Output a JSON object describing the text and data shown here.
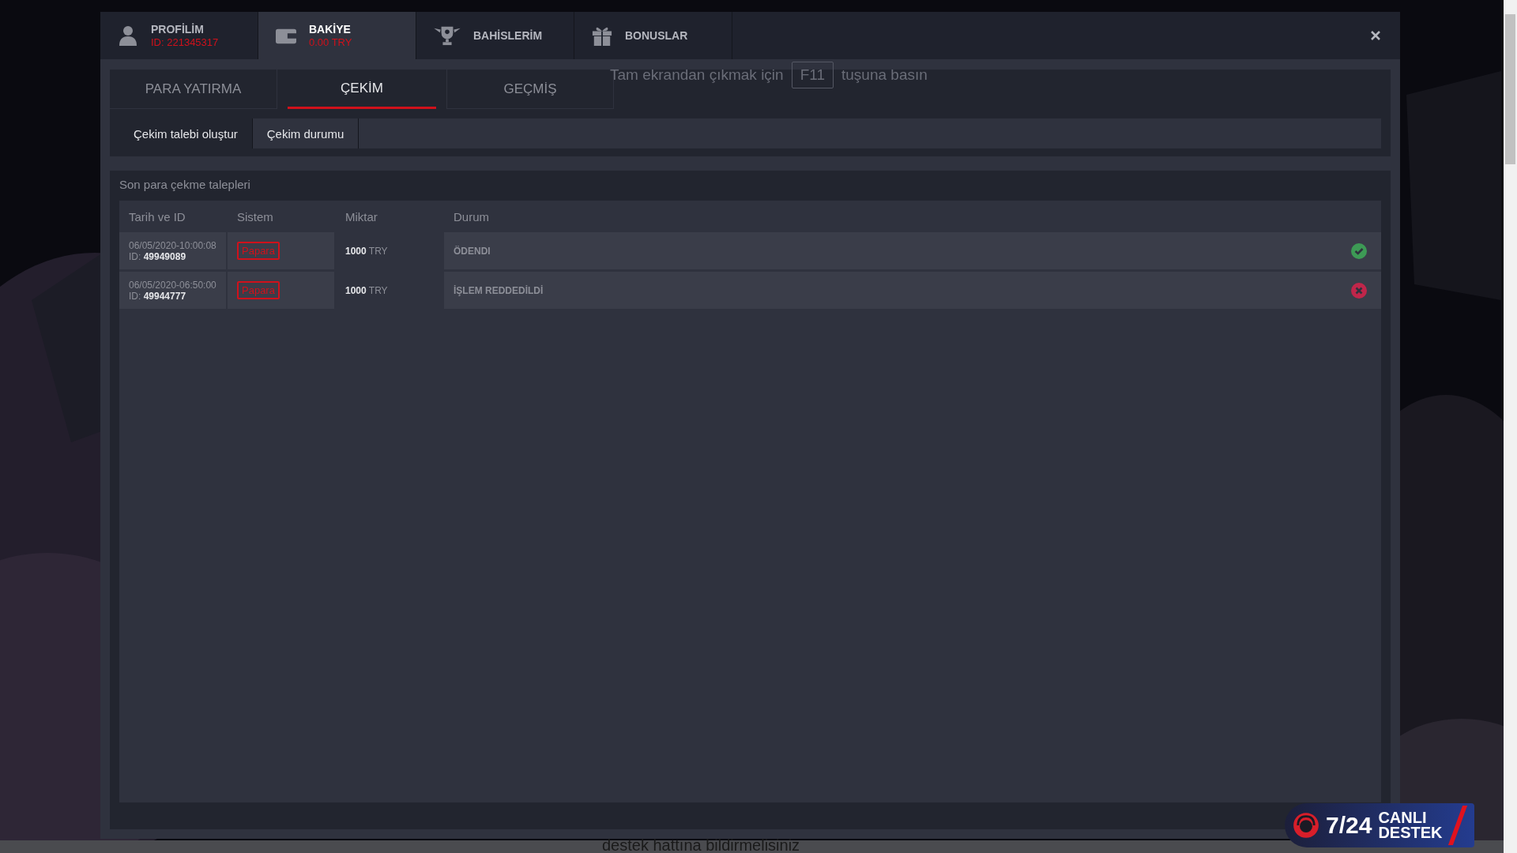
{
  "header_tabs": [
    {
      "kind": "profile",
      "label": "PROFİLİM",
      "sub": "ID: 221345317",
      "selected": false
    },
    {
      "kind": "balance",
      "label": "BAKİYE",
      "sub": "0.00 TRY",
      "selected": true
    },
    {
      "kind": "bets",
      "label": "BAHİSLERİM",
      "selected": false
    },
    {
      "kind": "bonus",
      "label": "BONUSLAR",
      "selected": false
    }
  ],
  "tabs": [
    {
      "label": "PARA YATIRMA",
      "selected": false
    },
    {
      "label": "ÇEKİM",
      "selected": true
    },
    {
      "label": "GEÇMİŞ",
      "selected": false
    }
  ],
  "subtabs": [
    {
      "label": "Çekim talebi oluştur",
      "selected": false
    },
    {
      "label": "Çekim durumu",
      "selected": true
    }
  ],
  "section_title": "Son para çekme talepleri",
  "table": {
    "columns": [
      "Tarih ve ID",
      "Sistem",
      "Miktar",
      "Durum"
    ],
    "rows": [
      {
        "date": "06/05/2020-10:00:08",
        "id_label": "ID:",
        "id": "49949089",
        "system": "Papara",
        "amount": "1000",
        "currency": "TRY",
        "status": "ÖDENDI",
        "paid": true
      },
      {
        "date": "06/05/2020-06:50:00",
        "id_label": "ID:",
        "id": "49944777",
        "system": "Papara",
        "amount": "1000",
        "currency": "TRY",
        "status": "İŞLEM REDDEDİLDİ",
        "paid": false
      }
    ]
  },
  "fullscreen_hint": {
    "before": "Tam ekrandan çıkmak için",
    "key": "F11",
    "after": "tuşuna basın"
  },
  "footer_text": "destek hattına bildirmelisiniz",
  "live_support": {
    "number": "7/24",
    "line1": "CANLI",
    "line2": "DESTEK"
  }
}
